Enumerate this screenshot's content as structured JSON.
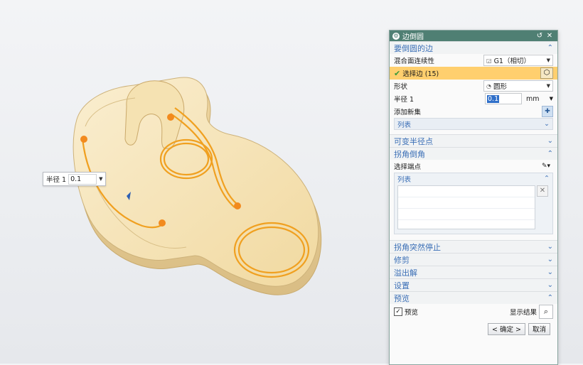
{
  "viewport": {
    "floating_radius": {
      "label": "半径 1",
      "value": "0.1"
    }
  },
  "dialog": {
    "title": "边倒圆",
    "edges_section": {
      "title": "要倒圆的边",
      "blend_continuity": {
        "label": "混合面连续性",
        "value": "G1（相切）"
      },
      "select_edge": {
        "label": "选择边 (15)"
      },
      "shape": {
        "label": "形状",
        "value": "圆形"
      },
      "radius": {
        "label": "半径 1",
        "value": "0.1",
        "unit": "mm"
      },
      "add_new_set": {
        "label": "添加新集"
      },
      "list": {
        "label": "列表"
      }
    },
    "variable_radius_section": {
      "title": "可变半径点"
    },
    "corner_section": {
      "title": "拐角倒角",
      "select_vertex": {
        "label": "选择端点"
      },
      "list": {
        "label": "列表"
      }
    },
    "corner_setback_section": {
      "title": "拐角突然停止"
    },
    "trim_section": {
      "title": "修剪"
    },
    "overflow_section": {
      "title": "溢出解"
    },
    "settings_section": {
      "title": "设置"
    },
    "preview_section": {
      "title": "预览",
      "preview_checkbox": {
        "label": "预览",
        "checked": true
      },
      "show_result": {
        "label": "显示结果"
      }
    },
    "buttons": {
      "ok": "< 确定 >",
      "cancel": "取消"
    }
  },
  "colors": {
    "title_bar": "#4f7f73",
    "section_title": "#3b6fb6",
    "selected_row": "#ffcf6e",
    "part_fill": "#f6e3b4",
    "edge_highlight": "#f0a020"
  },
  "icons": {
    "dialog": "gear-icon",
    "reset": "reset-icon",
    "close": "close-icon",
    "expand": "chevron-down-icon",
    "collapse": "chevron-up-icon",
    "select_object": "cube-icon",
    "add_set": "add-set-icon",
    "point_picker": "pencil-icon",
    "delete": "close-icon",
    "show_result": "magnifier-icon"
  }
}
